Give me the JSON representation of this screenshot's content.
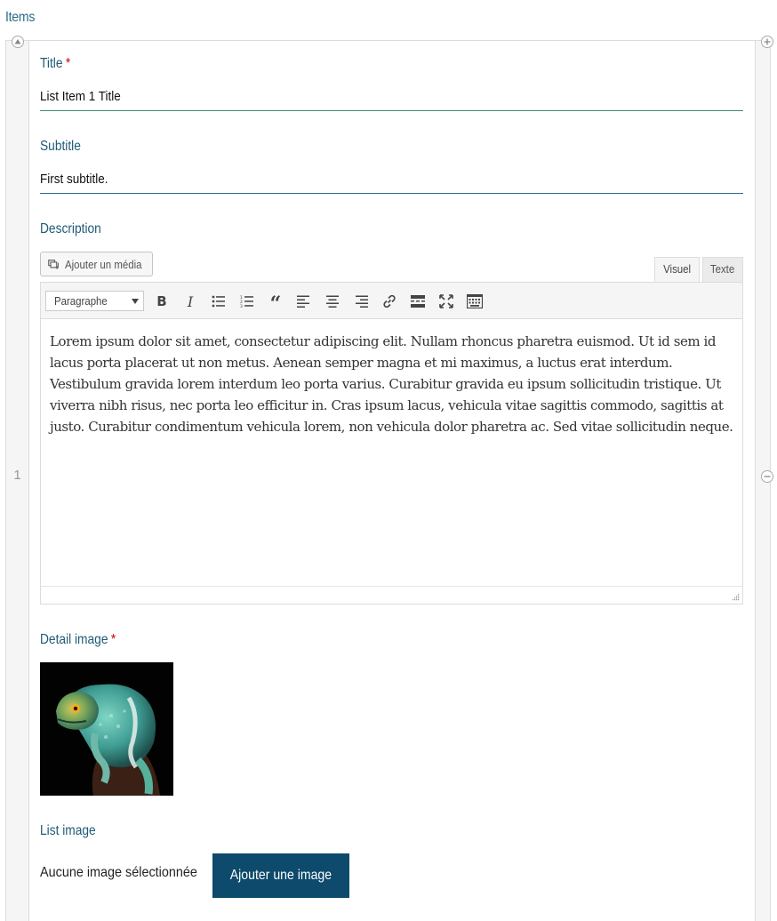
{
  "section": {
    "heading": "Items"
  },
  "row": {
    "number": "1",
    "title": {
      "label": "Title",
      "required_mark": "*",
      "value": "List Item 1 Title"
    },
    "subtitle": {
      "label": "Subtitle",
      "value": "First subtitle."
    },
    "description": {
      "label": "Description",
      "add_media_label": "Ajouter un média",
      "tabs": [
        "Visuel",
        "Texte"
      ],
      "active_tab": "Visuel",
      "format_select": "Paragraphe",
      "toolbar_icons": [
        "bold-icon",
        "italic-icon",
        "bullet-list-icon",
        "numbered-list-icon",
        "blockquote-icon",
        "align-left-icon",
        "align-center-icon",
        "align-right-icon",
        "link-icon",
        "read-more-icon",
        "fullscreen-icon",
        "toolbar-toggle-icon"
      ],
      "body": "Lorem ipsum dolor sit amet, consectetur adipiscing elit. Nullam rhoncus pharetra euismod. Ut id sem id lacus porta placerat ut non metus. Aenean semper magna et mi maximus, a luctus erat interdum. Vestibulum gravida lorem interdum leo porta varius. Curabitur gravida eu ipsum sollicitudin tristique. Ut viverra nibh risus, nec porta leo efficitur in. Cras ipsum lacus, vehicula vitae sagittis commodo, sagittis at justo. Curabitur condimentum vehicula lorem, non vehicula dolor pharetra ac. Sed vitae sollicitudin neque."
    },
    "detail_image": {
      "label": "Detail image",
      "required_mark": "*",
      "thumbnail": "lizard-thumbnail"
    },
    "list_image": {
      "label": "List image",
      "empty_text": "Aucune image sélectionnée",
      "add_button": "Ajouter une image"
    }
  },
  "colors": {
    "label": "#1f5a76",
    "button": "#0d4a6b",
    "required": "#cc0000"
  }
}
